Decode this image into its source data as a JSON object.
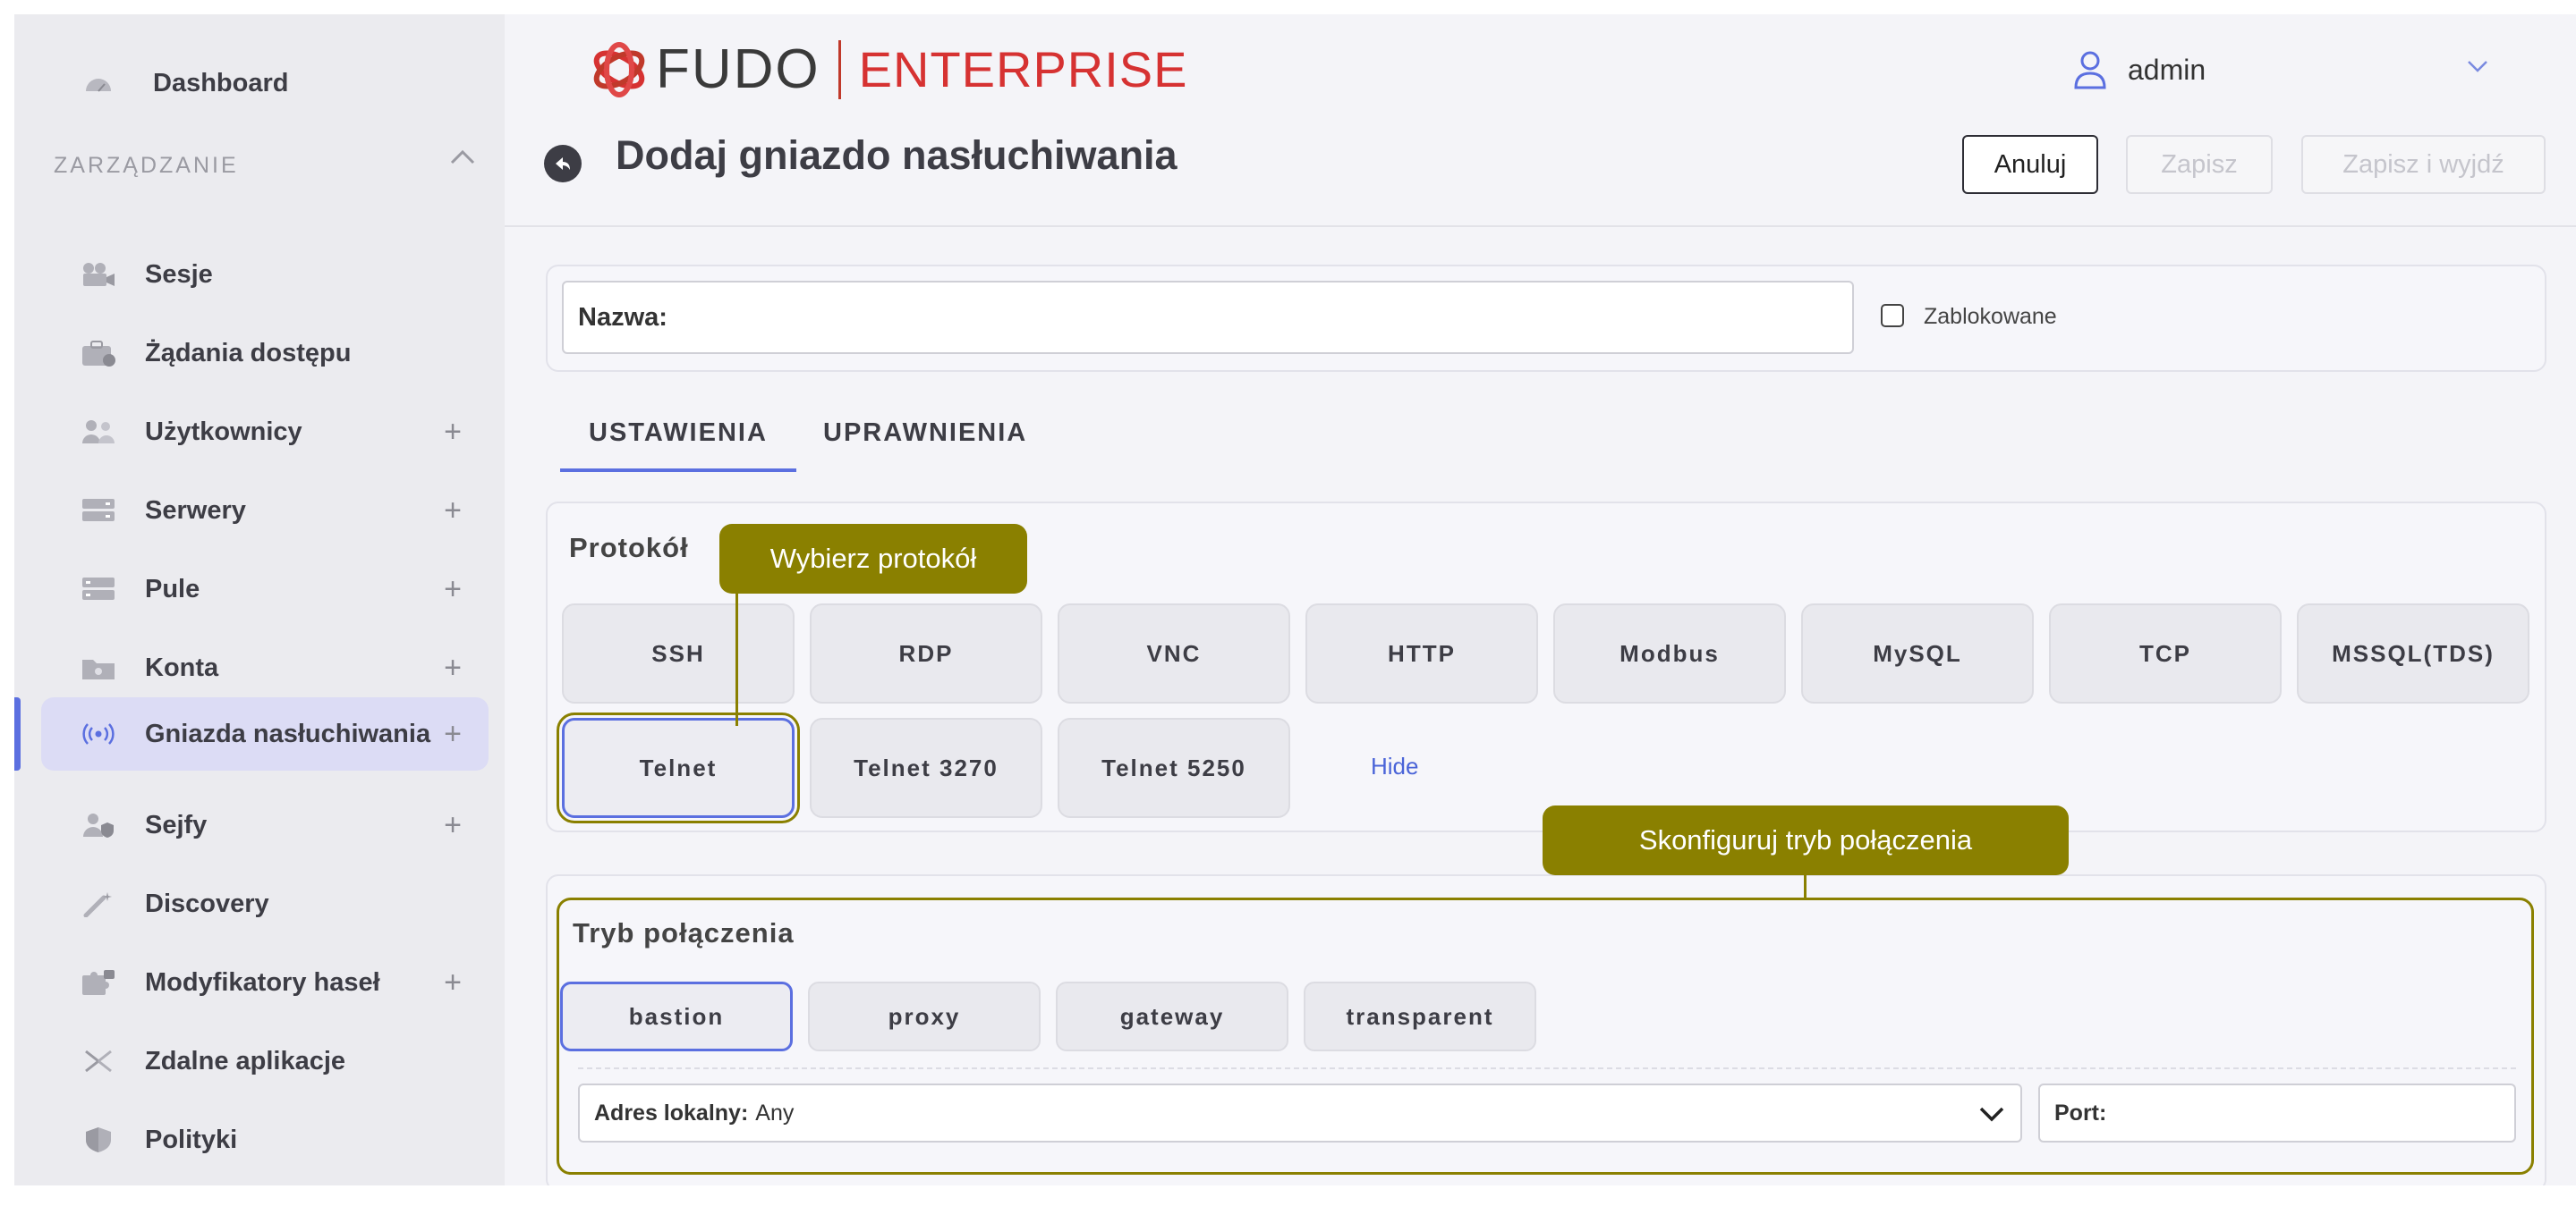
{
  "brand": {
    "name_primary": "FUDO",
    "name_secondary": "ENTERPRISE"
  },
  "sidebar": {
    "dashboard_label": "Dashboard",
    "section_label": "ZARZĄDZANIE",
    "items": [
      {
        "label": "Sesje",
        "icon": "camera-icon",
        "plus": false
      },
      {
        "label": "Żądania dostępu",
        "icon": "briefcase-icon",
        "plus": false
      },
      {
        "label": "Użytkownicy",
        "icon": "users-icon",
        "plus": true
      },
      {
        "label": "Serwery",
        "icon": "server-icon",
        "plus": true
      },
      {
        "label": "Pule",
        "icon": "pool-icon",
        "plus": true
      },
      {
        "label": "Konta",
        "icon": "folder-icon",
        "plus": true
      },
      {
        "label": "Gniazda nasłuchiwania",
        "icon": "broadcast-icon",
        "plus": true,
        "active": true
      },
      {
        "label": "Sejfy",
        "icon": "safe-icon",
        "plus": true
      },
      {
        "label": "Discovery",
        "icon": "wand-icon",
        "plus": false
      },
      {
        "label": "Modyfikatory haseł",
        "icon": "puzzle-icon",
        "plus": true
      },
      {
        "label": "Zdalne aplikacje",
        "icon": "remote-app-icon",
        "plus": false
      },
      {
        "label": "Polityki",
        "icon": "shield-icon",
        "plus": false
      }
    ],
    "plus_symbol": "+"
  },
  "header": {
    "user_name": "admin",
    "page_title": "Dodaj gniazdo nasłuchiwania",
    "cancel_label": "Anuluj",
    "save_label": "Zapisz",
    "save_exit_label": "Zapisz i wyjdź"
  },
  "form": {
    "name_label": "Nazwa:",
    "name_value": "",
    "blocked_label": "Zablokowane",
    "blocked_checked": false
  },
  "tabs": {
    "settings": "USTAWIENIA",
    "permissions": "UPRAWNIENIA",
    "active": "settings"
  },
  "protocol": {
    "title": "Protokół",
    "options": [
      "SSH",
      "RDP",
      "VNC",
      "HTTP",
      "Modbus",
      "MySQL",
      "TCP",
      "MSSQL(TDS)",
      "Telnet",
      "Telnet 3270",
      "Telnet 5250"
    ],
    "selected": "Telnet",
    "hide_label": "Hide"
  },
  "mode": {
    "title": "Tryb połączenia",
    "options": [
      "bastion",
      "proxy",
      "gateway",
      "transparent"
    ],
    "selected": "bastion",
    "local_address_label": "Adres lokalny:",
    "local_address_value": "Any",
    "port_label": "Port:",
    "port_value": ""
  },
  "tooltips": {
    "protocol": "Wybierz protokół",
    "mode": "Skonfiguruj tryb połączenia"
  },
  "colors": {
    "accent": "#5b6fe0",
    "annotation": "#8a8000",
    "brand_red": "#d63232",
    "active_nav_bg": "#dcdcf5"
  }
}
